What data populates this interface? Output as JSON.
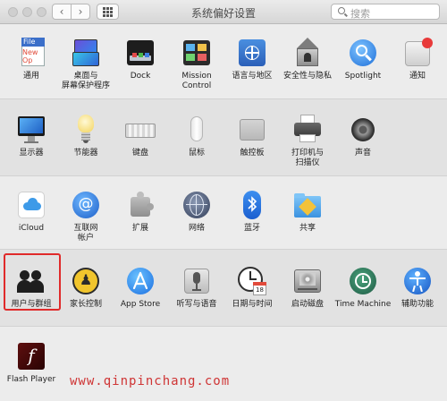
{
  "window": {
    "title": "系统偏好设置",
    "search_placeholder": "搜索"
  },
  "rows": [
    [
      {
        "label": "通用",
        "icon": "general-icon"
      },
      {
        "label": "桌面与\n屏幕保护程序",
        "icon": "desktop-screensaver-icon"
      },
      {
        "label": "Dock",
        "icon": "dock-icon"
      },
      {
        "label": "Mission\nControl",
        "icon": "mission-control-icon"
      },
      {
        "label": "语言与地区",
        "icon": "language-region-icon"
      },
      {
        "label": "安全性与隐私",
        "icon": "security-privacy-icon"
      },
      {
        "label": "Spotlight",
        "icon": "spotlight-icon"
      },
      {
        "label": "通知",
        "icon": "notifications-icon"
      }
    ],
    [
      {
        "label": "显示器",
        "icon": "displays-icon"
      },
      {
        "label": "节能器",
        "icon": "energy-saver-icon"
      },
      {
        "label": "键盘",
        "icon": "keyboard-icon"
      },
      {
        "label": "鼠标",
        "icon": "mouse-icon"
      },
      {
        "label": "触控板",
        "icon": "trackpad-icon"
      },
      {
        "label": "打印机与\n扫描仪",
        "icon": "printers-scanners-icon"
      },
      {
        "label": "声音",
        "icon": "sound-icon"
      }
    ],
    [
      {
        "label": "iCloud",
        "icon": "icloud-icon"
      },
      {
        "label": "互联网\n帐户",
        "icon": "internet-accounts-icon"
      },
      {
        "label": "扩展",
        "icon": "extensions-icon"
      },
      {
        "label": "网络",
        "icon": "network-icon"
      },
      {
        "label": "蓝牙",
        "icon": "bluetooth-icon"
      },
      {
        "label": "共享",
        "icon": "sharing-icon"
      }
    ],
    [
      {
        "label": "用户与群组",
        "icon": "users-groups-icon"
      },
      {
        "label": "家长控制",
        "icon": "parental-controls-icon"
      },
      {
        "label": "App Store",
        "icon": "app-store-icon"
      },
      {
        "label": "听写与语音",
        "icon": "dictation-speech-icon"
      },
      {
        "label": "日期与时间",
        "icon": "date-time-icon"
      },
      {
        "label": "启动磁盘",
        "icon": "startup-disk-icon"
      },
      {
        "label": "Time Machine",
        "icon": "time-machine-icon"
      },
      {
        "label": "辅助功能",
        "icon": "accessibility-icon"
      }
    ],
    [
      {
        "label": "Flash Player",
        "icon": "flash-player-icon"
      }
    ]
  ],
  "icon_texts": {
    "general_file": "File",
    "general_new": "New",
    "general_op": "Op",
    "flash_glyph": "f",
    "calendar_day": "18",
    "parental_glyph": "♟"
  },
  "watermark": "www.qinpinchang.com"
}
